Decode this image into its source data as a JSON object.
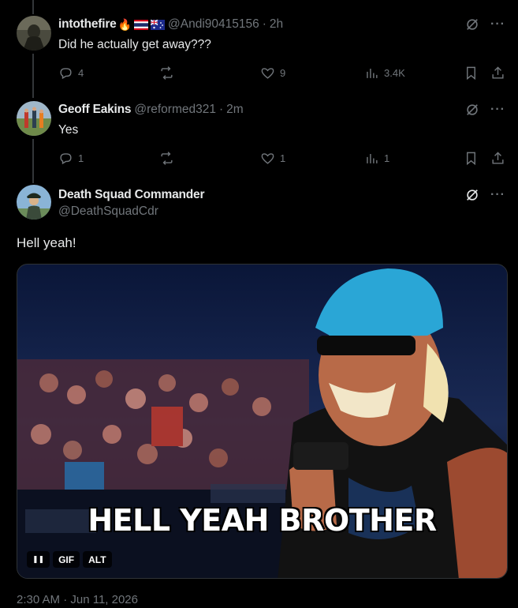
{
  "posts": [
    {
      "name": "intothefire",
      "name_emoji": "🔥",
      "handle": "@Andi90415156",
      "sep": "·",
      "time": "2h",
      "text": "Did he actually get away???",
      "stats": {
        "replies": "4",
        "reposts": "",
        "likes": "9",
        "views": "3.4K"
      }
    },
    {
      "name": "Geoff Eakins",
      "handle": "@reformed321",
      "sep": "·",
      "time": "2m",
      "text": "Yes",
      "stats": {
        "replies": "1",
        "reposts": "",
        "likes": "1",
        "views": "1"
      }
    }
  ],
  "main_post": {
    "name": "Death Squad Commander",
    "handle": "@DeathSquadCdr",
    "text": "Hell yeah!",
    "gif_caption": "HELL YEAH BROTHER",
    "badges": {
      "pause": "❚❚",
      "gif": "GIF",
      "alt": "ALT"
    },
    "timestamp": "2:30 AM · Jun 11, 2026"
  },
  "icons": {
    "grok": "grok-icon",
    "more": "···",
    "reply": "reply-icon",
    "repost": "repost-icon",
    "like": "heart-icon",
    "views": "views-icon",
    "bookmark": "bookmark-icon",
    "share": "share-icon"
  },
  "colors": {
    "background": "#000000",
    "text": "#e7e9ea",
    "muted": "#71767b",
    "thread": "#333639"
  }
}
